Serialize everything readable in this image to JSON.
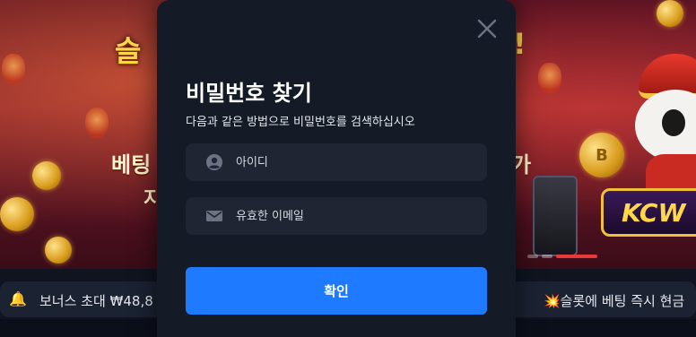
{
  "banner": {
    "left_title": "슬",
    "left_sub1": "베팅",
    "left_sub2": "지",
    "right_mark": "!",
    "right_sub": "가",
    "brand_badge": "KCW",
    "coin_symbol": "B"
  },
  "ticker": {
    "bell_icon": "🔔",
    "left_text": "보너스 초대 ₩48,8",
    "right_text": "💥슬롯에 베팅 즉시 현금"
  },
  "modal": {
    "title": "비밀번호 찾기",
    "description": "다음과 같은 방법으로 비밀번호를 검색하십시오",
    "fields": {
      "username": {
        "placeholder": "아이디",
        "value": "",
        "icon": "user-circle-icon"
      },
      "email": {
        "placeholder": "유효한 이메일",
        "value": "",
        "icon": "mail-icon"
      }
    },
    "confirm_label": "확인",
    "close_icon": "close-icon"
  },
  "colors": {
    "modal_bg": "#141a26",
    "field_bg": "#1f2533",
    "accent": "#1e7bff"
  }
}
